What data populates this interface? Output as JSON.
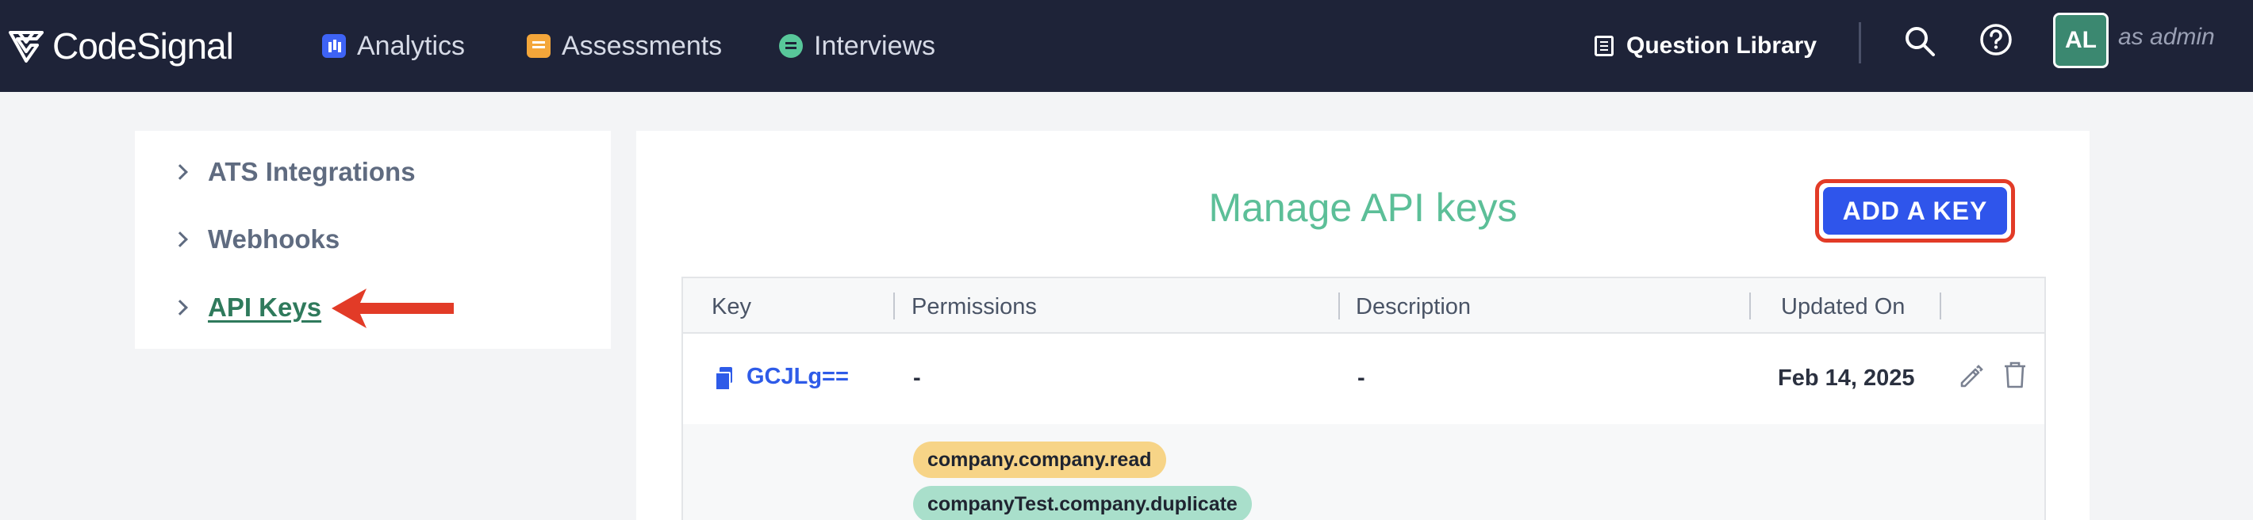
{
  "header": {
    "brand": "CodeSignal",
    "nav": [
      {
        "label": "Analytics",
        "icon": "analytics-icon"
      },
      {
        "label": "Assessments",
        "icon": "assessments-icon"
      },
      {
        "label": "Interviews",
        "icon": "interviews-icon"
      }
    ],
    "question_library": "Question Library",
    "avatar_initials": "AL",
    "role_text": "as admin"
  },
  "sidebar": {
    "items": [
      {
        "label": "ATS Integrations",
        "active": false
      },
      {
        "label": "Webhooks",
        "active": false
      },
      {
        "label": "API Keys",
        "active": true
      }
    ]
  },
  "main": {
    "title": "Manage API keys",
    "add_button": "ADD A KEY",
    "table": {
      "columns": [
        "Key",
        "Permissions",
        "Description",
        "Updated On"
      ],
      "rows": [
        {
          "key": "GCJLg==",
          "permissions": "-",
          "description": "-",
          "updated_on": "Feb 14, 2025"
        }
      ],
      "expanded_permissions": [
        "company.company.read",
        "companyTest.company.duplicate"
      ]
    }
  },
  "colors": {
    "topbar": "#1e2338",
    "accent_green": "#5cbf98",
    "button_blue": "#2f55eb",
    "highlight_red": "#e23b27"
  }
}
